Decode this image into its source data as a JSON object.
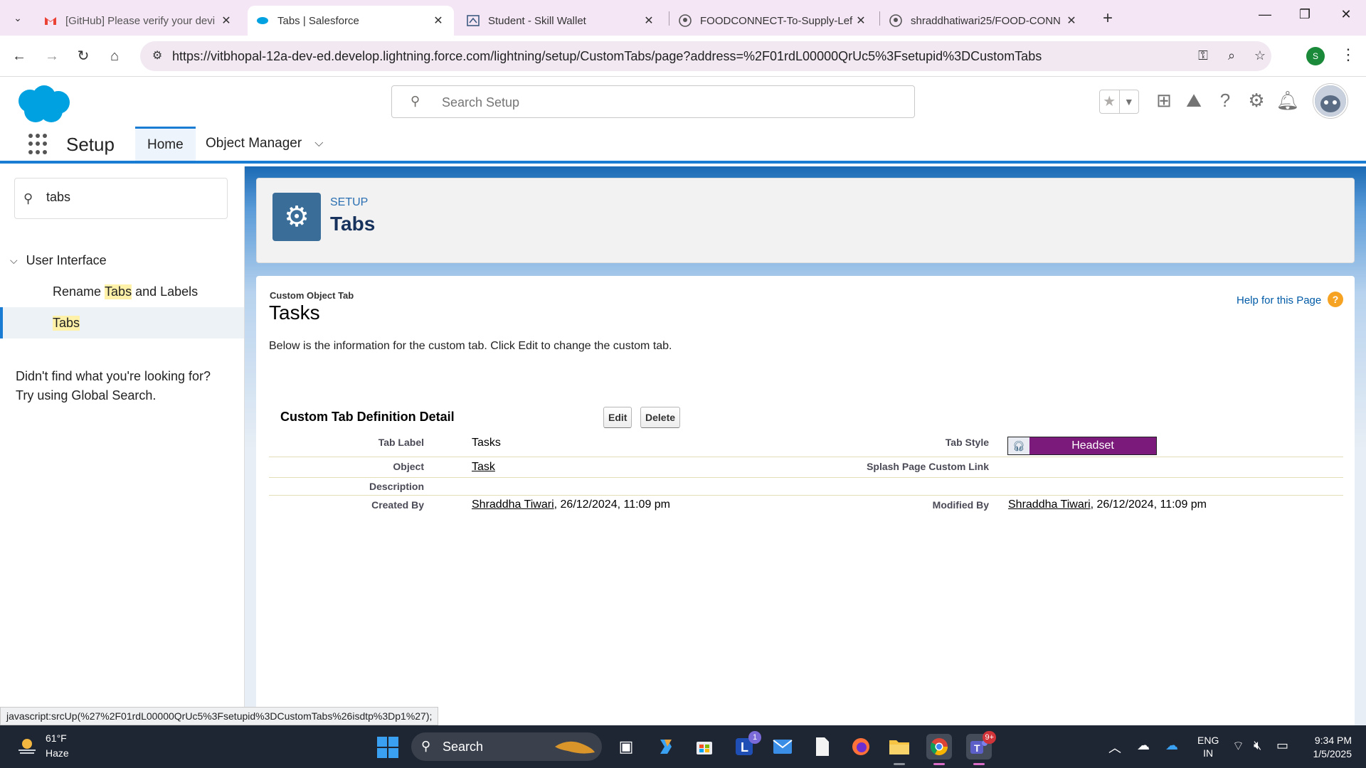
{
  "browser": {
    "tabs": [
      {
        "title": "[GitHub] Please verify your devi",
        "favicon": "gmail-icon",
        "active": false
      },
      {
        "title": "Tabs | Salesforce",
        "favicon": "salesforce-cloud-icon",
        "active": true
      },
      {
        "title": "Student - Skill Wallet",
        "favicon": "skill-wallet-icon",
        "active": false
      },
      {
        "title": "FOODCONNECT-To-Supply-Lef",
        "favicon": "github-icon",
        "active": false
      },
      {
        "title": "shraddhatiwari25/FOOD-CONN",
        "favicon": "github-icon",
        "active": false
      }
    ],
    "url": "https://vitbhopal-12a-dev-ed.develop.lightning.force.com/lightning/setup/CustomTabs/page?address=%2F01rdL00000QrUc5%3Fsetupid%3DCustomTabs",
    "profile_initial": "S"
  },
  "sf": {
    "search_placeholder": "Search Setup",
    "app_name": "Setup",
    "nav": {
      "home": "Home",
      "object_manager": "Object Manager"
    }
  },
  "sidebar": {
    "quick_find_value": "tabs",
    "group": "User Interface",
    "items": [
      {
        "pre": "Rename ",
        "hl": "Tabs",
        "post": " and Labels"
      },
      {
        "pre": "",
        "hl": "Tabs",
        "post": ""
      }
    ],
    "not_found_line1": "Didn't find what you're looking for?",
    "not_found_line2": "Try using Global Search."
  },
  "header": {
    "eyebrow": "SETUP",
    "title": "Tabs"
  },
  "detail": {
    "type_label": "Custom Object Tab",
    "name": "Tasks",
    "help": "Help for this Page",
    "intro": "Below is the information for the custom tab. Click Edit to change the custom tab.",
    "section_title": "Custom Tab Definition Detail",
    "edit": "Edit",
    "delete": "Delete",
    "fields": {
      "tab_label_lbl": "Tab Label",
      "tab_label_val": "Tasks",
      "tab_style_lbl": "Tab Style",
      "tab_style_val": "Headset",
      "object_lbl": "Object",
      "object_val": "Task",
      "splash_lbl": "Splash Page Custom Link",
      "description_lbl": "Description",
      "created_by_lbl": "Created By",
      "created_by_user": "Shraddha Tiwari",
      "created_by_date": ", 26/12/2024, 11:09 pm",
      "modified_by_lbl": "Modified By",
      "modified_by_user": "Shraddha Tiwari",
      "modified_by_date": ", 26/12/2024, 11:09 pm"
    },
    "tab_style_color": "#7b1a7b"
  },
  "status_bar": "javascript:srcUp(%27%2F01rdL00000QrUc5%3Fsetupid%3DCustomTabs%26isdtp%3Dp1%27);",
  "taskbar": {
    "temp": "61°F",
    "condition": "Haze",
    "search": "Search",
    "lang1": "ENG",
    "lang2": "IN",
    "time": "9:34 PM",
    "date": "1/5/2025",
    "badges": {
      "l_app": "1",
      "teams": "9+"
    }
  }
}
